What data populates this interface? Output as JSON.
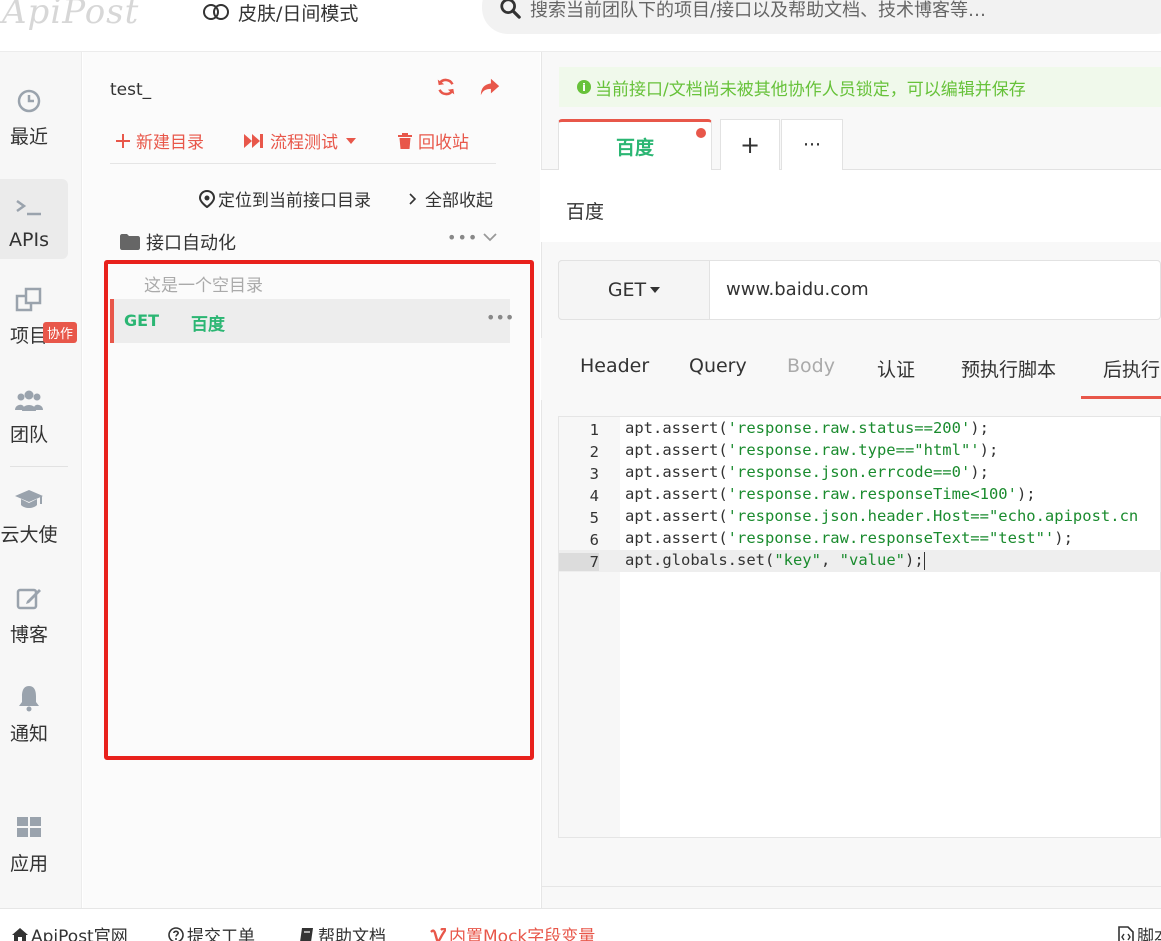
{
  "app": {
    "logo_text": "ApiPost",
    "skin_toggle_label": "皮肤/日间模式",
    "search_placeholder": "搜索当前团队下的项目/接口以及帮助文档、技术博客等…"
  },
  "left_nav": {
    "items": [
      {
        "label": "最近",
        "icon": "clock-icon"
      },
      {
        "label": "APIs",
        "icon": "terminal-icon",
        "active": true
      },
      {
        "label": "项目",
        "icon": "project-icon"
      },
      {
        "label": "团队",
        "icon": "team-icon",
        "badge": "协作"
      },
      {
        "label": "云大使",
        "icon": "graduation-cap-icon"
      },
      {
        "label": "博客",
        "icon": "edit-icon"
      },
      {
        "label": "通知",
        "icon": "bell-icon"
      },
      {
        "label": "应用",
        "icon": "apps-icon"
      }
    ]
  },
  "sidebar": {
    "project_title": "test_",
    "actions": {
      "new_folder": "新建目录",
      "flow_test": "流程测试",
      "recycle": "回收站"
    },
    "locate_label": "定位到当前接口目录",
    "collapse_label": "全部收起",
    "folder": {
      "name": "接口自动化",
      "empty_text": "这是一个空目录"
    },
    "api_item": {
      "method": "GET",
      "name": "百度"
    }
  },
  "main": {
    "lock_notice": "当前接口/文档尚未被其他协作人员锁定，可以编辑并保存",
    "tabs": {
      "active_label": "百度",
      "add_label": "+",
      "more_label": "···"
    },
    "api_title": "百度",
    "request": {
      "method": "GET",
      "url": "www.baidu.com"
    },
    "req_tabs": [
      "Header",
      "Query",
      "Body",
      "认证",
      "预执行脚本",
      "后执行"
    ],
    "code_lines": [
      {
        "num": "1",
        "pre": "apt.assert(",
        "str": "'response.raw.status==200'",
        "post": ");"
      },
      {
        "num": "2",
        "pre": "apt.assert(",
        "str": "'response.raw.type==\"html\"'",
        "post": ");"
      },
      {
        "num": "3",
        "pre": "apt.assert(",
        "str": "'response.json.errcode==0'",
        "post": ");"
      },
      {
        "num": "4",
        "pre": "apt.assert(",
        "str": "'response.raw.responseTime<100'",
        "post": ");"
      },
      {
        "num": "5",
        "pre": "apt.assert(",
        "str": "'response.json.header.Host==\"echo.apipost.cn",
        "post": ""
      },
      {
        "num": "6",
        "pre": "apt.assert(",
        "str": "'response.raw.responseText==\"test\"'",
        "post": ");"
      },
      {
        "num": "7",
        "pre": "apt.globals.set(",
        "str": "\"key\"",
        "mid": ", ",
        "str2": "\"value\"",
        "post": ");"
      }
    ]
  },
  "statusbar": {
    "official_site": "ApiPost官网",
    "ticket": "提交工单",
    "docs": "帮助文档",
    "mock": "内置Mock字段变量",
    "script": "脚本"
  },
  "colors": {
    "accent_red": "#e8574a",
    "green": "#2bb673",
    "highlight_frame": "#e8211c"
  }
}
